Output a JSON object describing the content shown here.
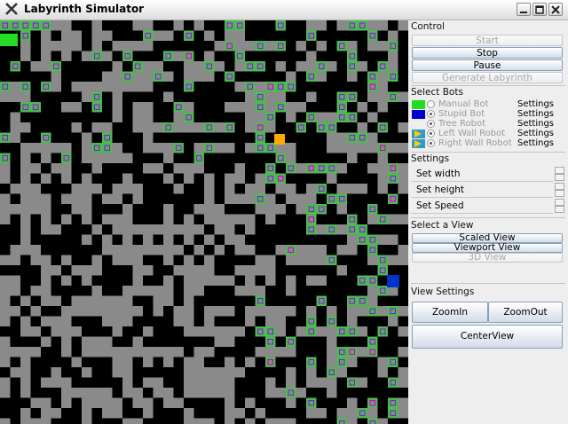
{
  "window": {
    "title": "Labyrinth Simulator",
    "controls": [
      "minimize-icon",
      "maximize-icon",
      "close-icon"
    ]
  },
  "control": {
    "heading": "Control",
    "start_label": "Start",
    "stop_label": "Stop",
    "pause_label": "Pause",
    "generate_label": "Generate Labyrinth"
  },
  "bots": {
    "heading": "Select Bots",
    "items": [
      {
        "name": "Manual Bot",
        "settings": "Settings",
        "color": "#22dd22",
        "selected": false
      },
      {
        "name": "Stupid Bot",
        "settings": "Settings",
        "color": "#0000cc",
        "selected": true
      },
      {
        "name": "Tree Robot",
        "settings": "Settings",
        "color": "",
        "selected": true
      },
      {
        "name": "Left Wall Robot",
        "settings": "Settings",
        "color": "#3399cc",
        "selected": true
      },
      {
        "name": "Right Wall Robot",
        "settings": "Settings",
        "color": "#3399cc",
        "selected": true
      }
    ]
  },
  "settings": {
    "heading": "Settings",
    "width_label": "Set width",
    "height_label": "Set height",
    "speed_label": "Set Speed"
  },
  "view": {
    "heading": "Select a View",
    "scaled_label": "Scaled View",
    "viewport_label": "Viewport View",
    "view3d_label": "3D View"
  },
  "view_settings": {
    "heading": "View Settings",
    "zoomin_label": "ZoomIn",
    "zoomout_label": "ZoomOut",
    "center_label": "CenterView"
  },
  "maze": {
    "colors": {
      "wall": "#000000",
      "path": "#8a8a8a",
      "visited": "#22dd22",
      "marker": "#4444aa",
      "magenta": "#cc00cc",
      "robot": "#ffaa00",
      "goal": "#0033cc"
    }
  }
}
